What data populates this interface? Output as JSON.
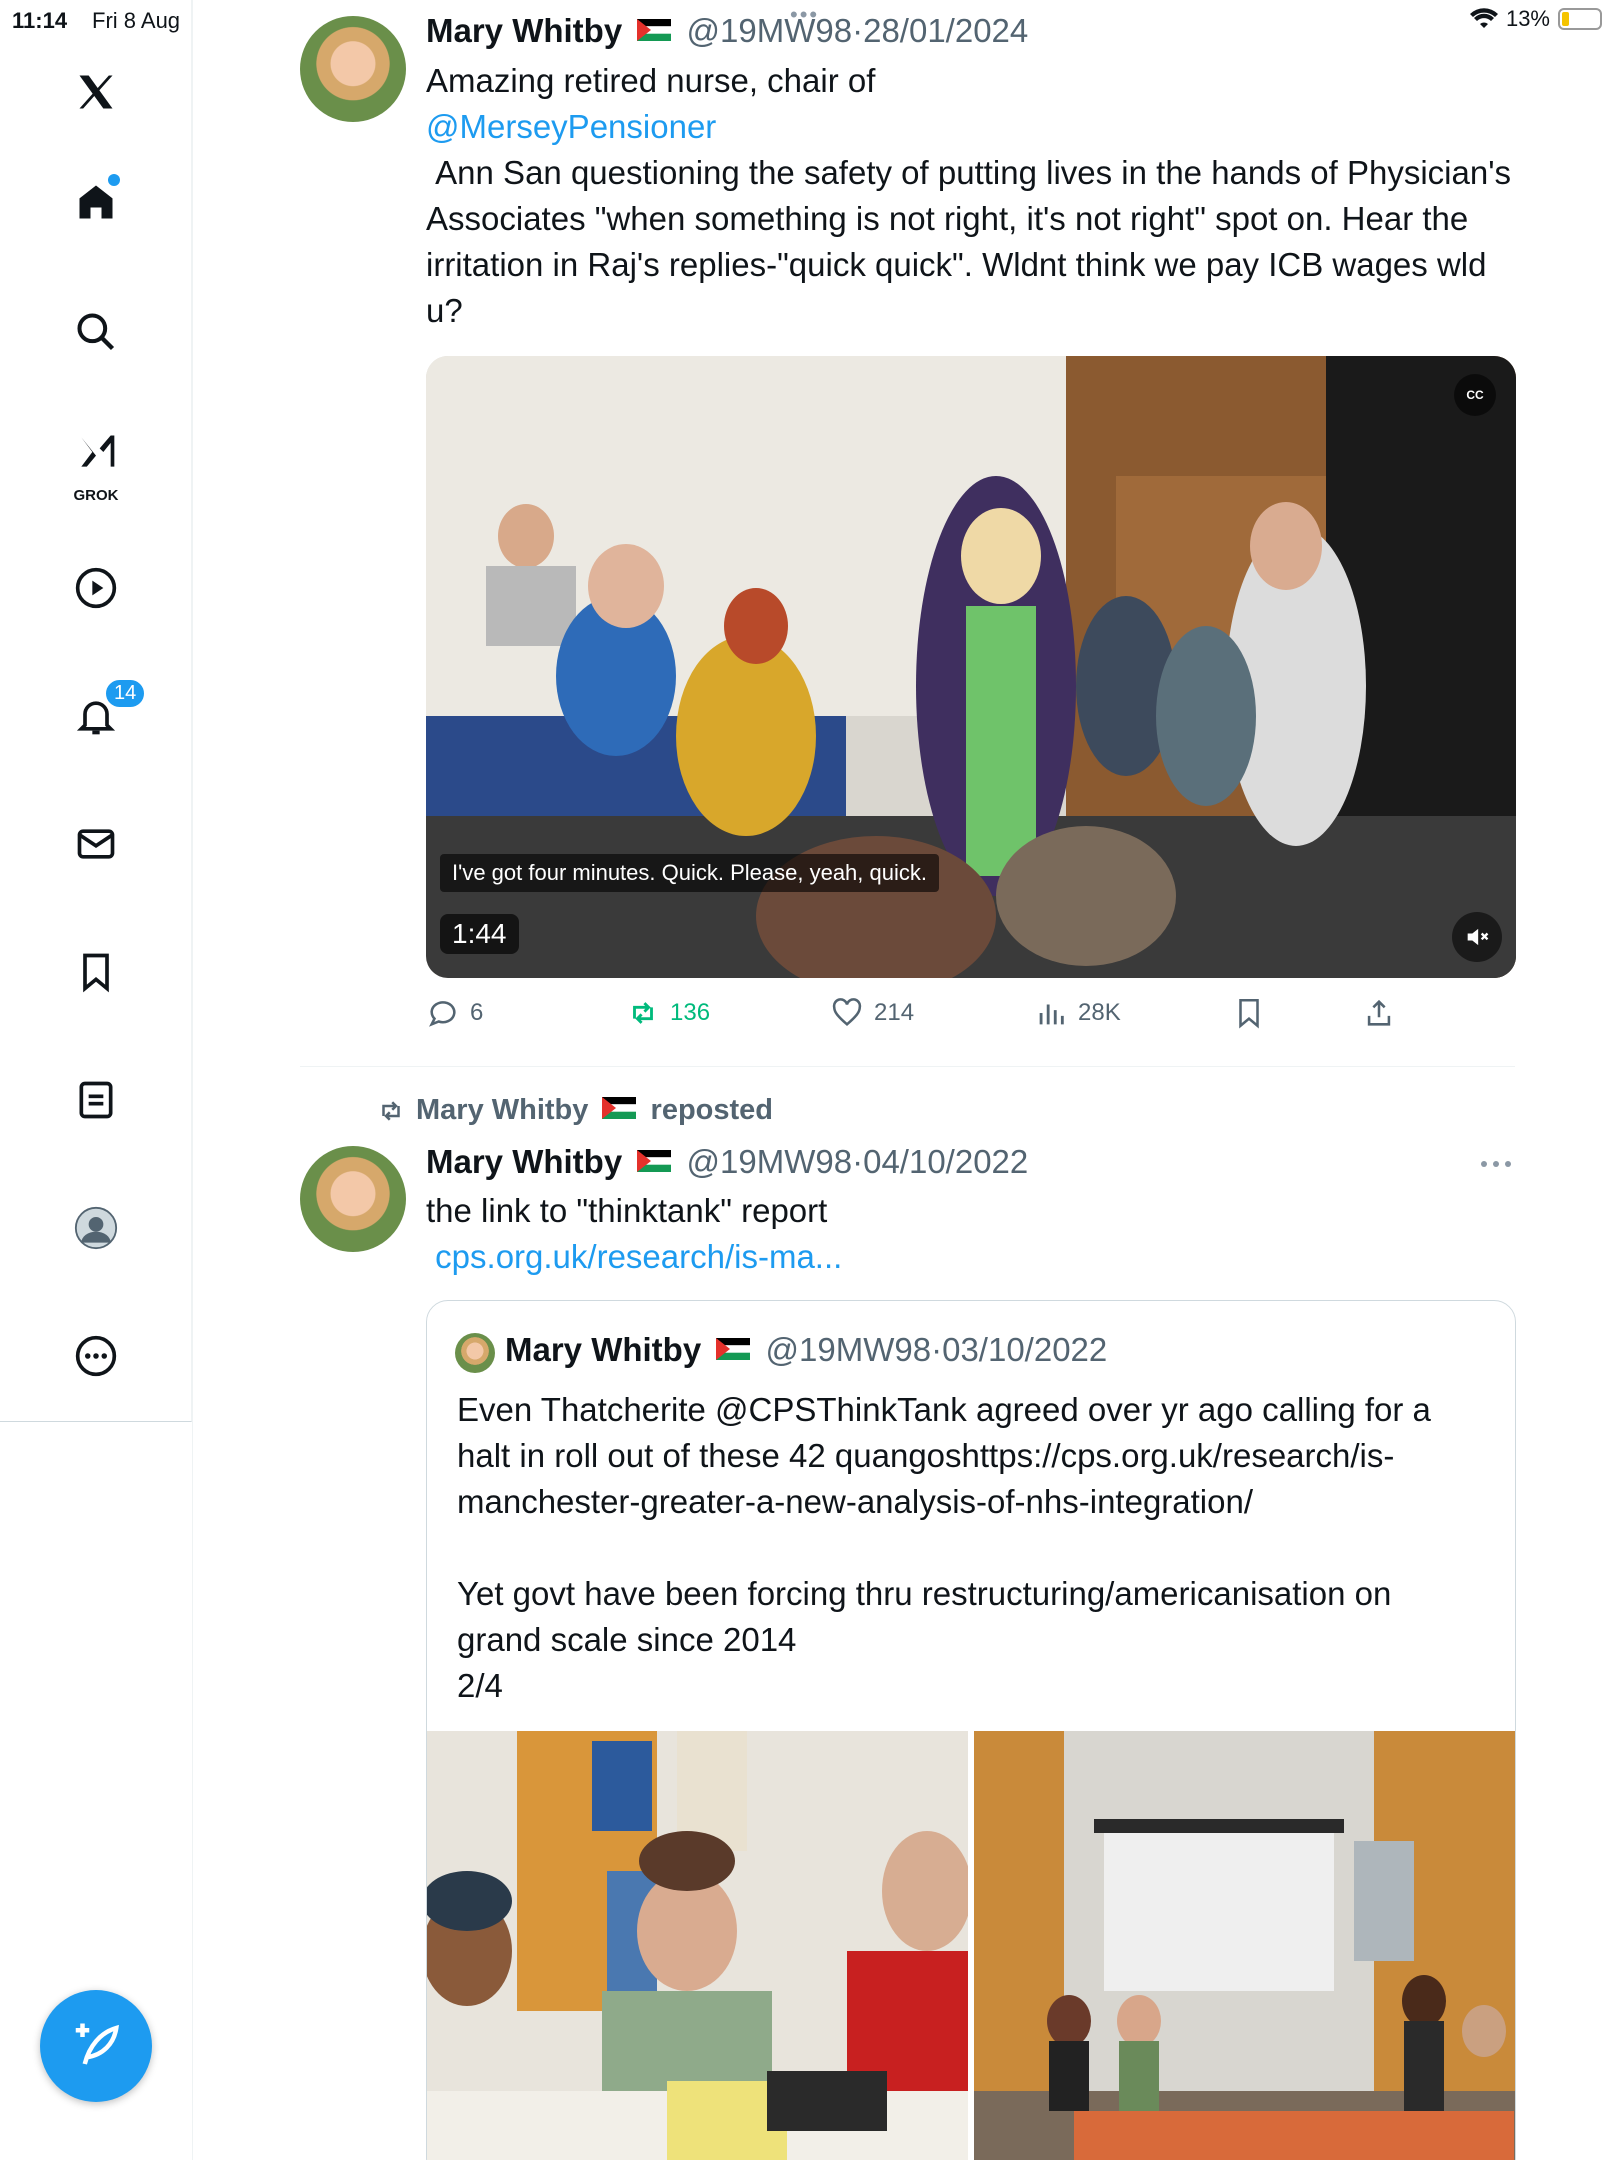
{
  "status_bar": {
    "time": "11:14",
    "date": "Fri 8 Aug",
    "battery": "13%"
  },
  "sidebar": {
    "notifications_badge": "14",
    "grok_label": "GROK",
    "icons": [
      "x-logo-icon",
      "home-icon",
      "search-icon",
      "grok-icon",
      "video-icon",
      "bell-icon",
      "mail-icon",
      "bookmark-icon",
      "list-icon",
      "profile-icon",
      "more-icon",
      "compose-icon"
    ]
  },
  "tweet1": {
    "name": "Mary Whitby",
    "handle": "@19MW98",
    "date": "28/01/2024",
    "text_intro": "Amazing retired nurse, chair of",
    "mention": "@MerseyPensioner",
    "text_body": " Ann San questioning the safety of putting lives in the hands of Physician's Associates \"when something is not right, it's not right\" spot on. Hear the irritation in Raj's replies-\"quick quick\". Wldnt think we pay ICB wages wld u?",
    "video": {
      "caption": "I've got four minutes. Quick. Please, yeah, quick.",
      "duration": "1:44",
      "cc": "CC"
    },
    "stats": {
      "replies": "6",
      "reposts": "136",
      "likes": "214",
      "views": "28K"
    }
  },
  "tweet2": {
    "repost_label": "Mary Whitby",
    "repost_suffix": "reposted",
    "name": "Mary Whitby",
    "handle": "@19MW98",
    "date": "04/10/2022",
    "text": "the link to \"thinktank\" report",
    "link": " cps.org.uk/research/is-ma...",
    "quoted": {
      "name": "Mary Whitby",
      "handle": "@19MW98",
      "date": "03/10/2022",
      "text_line1": "Even Thatcherite @CPSThinkTank agreed over yr ago calling for a",
      "text_line2": "halt in roll out of these 42 quangoshttps://cps.org.uk/research/is-",
      "text_line3": "manchester-greater-a-new-analysis-of-nhs-integration/",
      "text_line4": "Yet govt have been forcing thru restructuring/americanisation on",
      "text_line5": "grand scale since 2014",
      "text_line6": "2/4"
    }
  },
  "colors": {
    "accent": "#1d9bf0",
    "repost_green": "#00ba7c",
    "muted": "#536471"
  }
}
